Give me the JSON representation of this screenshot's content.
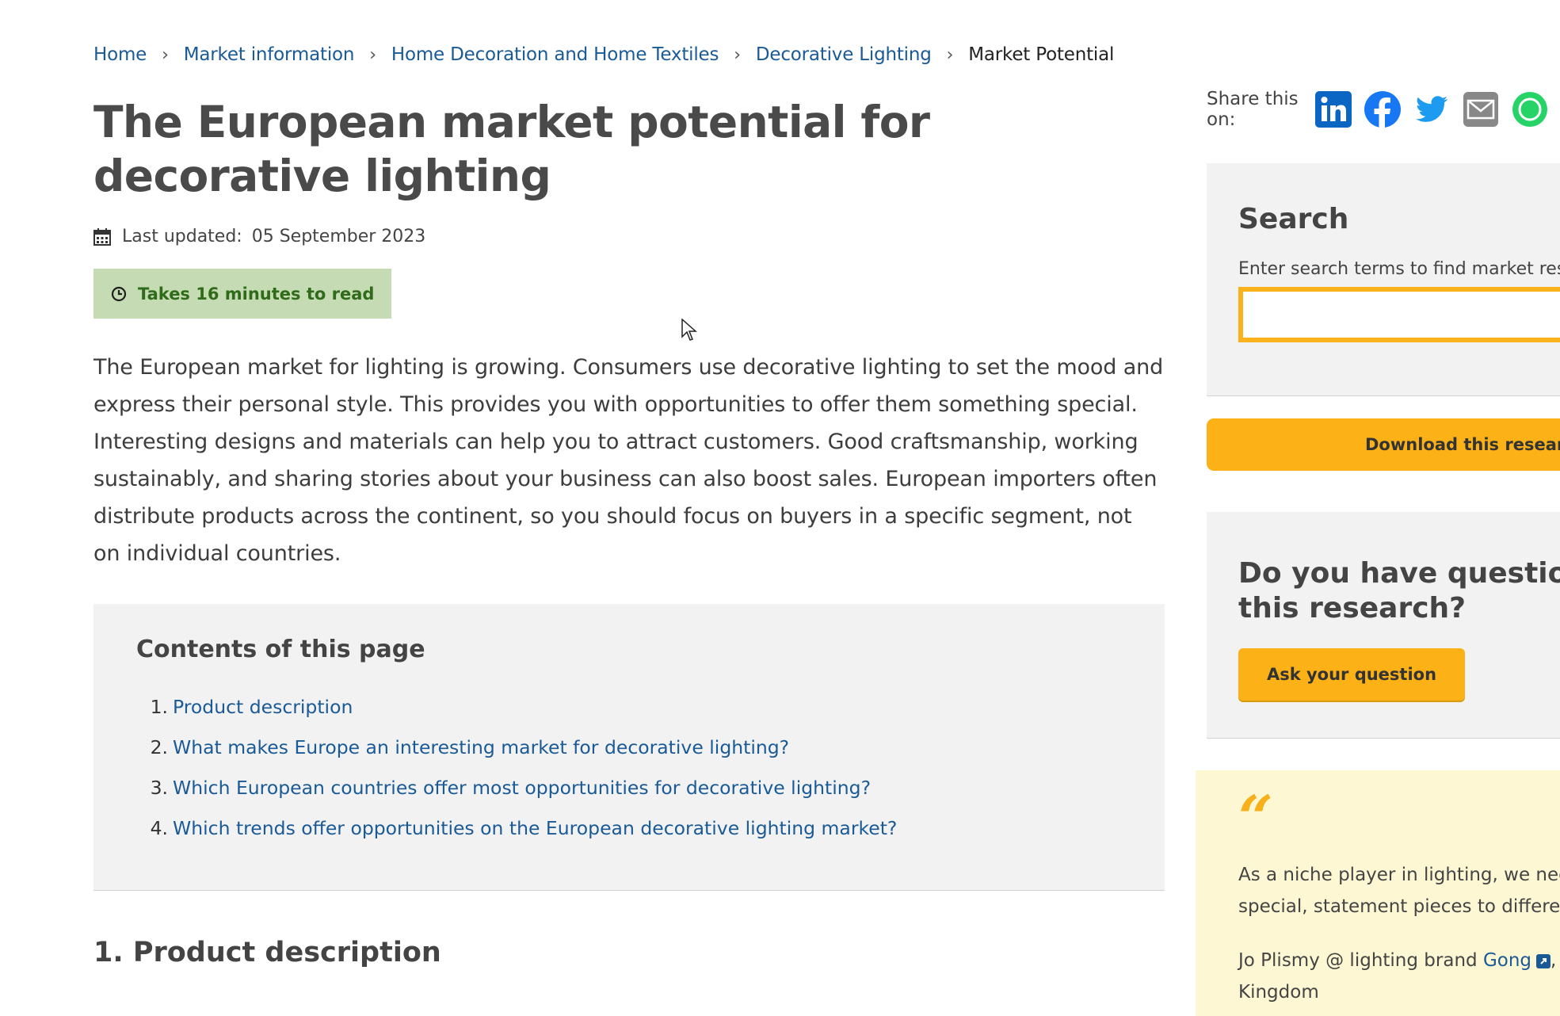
{
  "breadcrumb": {
    "items": [
      "Home",
      "Market information",
      "Home Decoration and Home Textiles",
      "Decorative Lighting"
    ],
    "current": "Market Potential",
    "separator": "›"
  },
  "page": {
    "title": "The European market potential for decorative lighting",
    "last_updated_label": "Last updated:",
    "last_updated_value": "05 September 2023",
    "read_time": "Takes 16 minutes to read",
    "intro": "The European market for lighting is growing. Consumers use decorative lighting to set the mood and express their personal style. This provides you with opportunities to offer them something special. Interesting designs and materials can help you to attract customers. Good craftsmanship, working sustainably, and sharing stories about your business can also boost sales. European importers often distribute products across the continent, so you should focus on buyers in a specific segment, not on individual countries."
  },
  "toc": {
    "title": "Contents of this page",
    "items": [
      {
        "num": "1.",
        "label": "Product description"
      },
      {
        "num": "2.",
        "label": "What makes Europe an interesting market for decorative lighting?"
      },
      {
        "num": "3.",
        "label": "Which European countries offer most opportunities for decorative lighting?"
      },
      {
        "num": "4.",
        "label": "Which trends offer opportunities on the European decorative lighting market?"
      }
    ]
  },
  "section": {
    "title": "1. Product description"
  },
  "share": {
    "label": "Share this on:",
    "icons": [
      "linkedin-icon",
      "facebook-icon",
      "twitter-icon",
      "email-icon",
      "whatsapp-icon"
    ]
  },
  "search": {
    "title": "Search",
    "hint": "Enter search terms to find market res",
    "value": ""
  },
  "download": {
    "label": "Download this research"
  },
  "questions": {
    "title": "Do you have questions a\nthis research?",
    "button": "Ask your question"
  },
  "quote": {
    "mark": "“",
    "text": "As a niche player in lighting, we need\nspecial, statement pieces to different",
    "author_prefix": "Jo Plismy @ lighting brand ",
    "author_link": "Gong",
    "author_suffix": ", t\nKingdom"
  },
  "colors": {
    "link": "#1a5a96",
    "accent": "#fcb216",
    "read_time_bg": "#c5dbb3",
    "quote_bg": "#fdf8d3",
    "panel_bg": "#f2f2f2"
  }
}
